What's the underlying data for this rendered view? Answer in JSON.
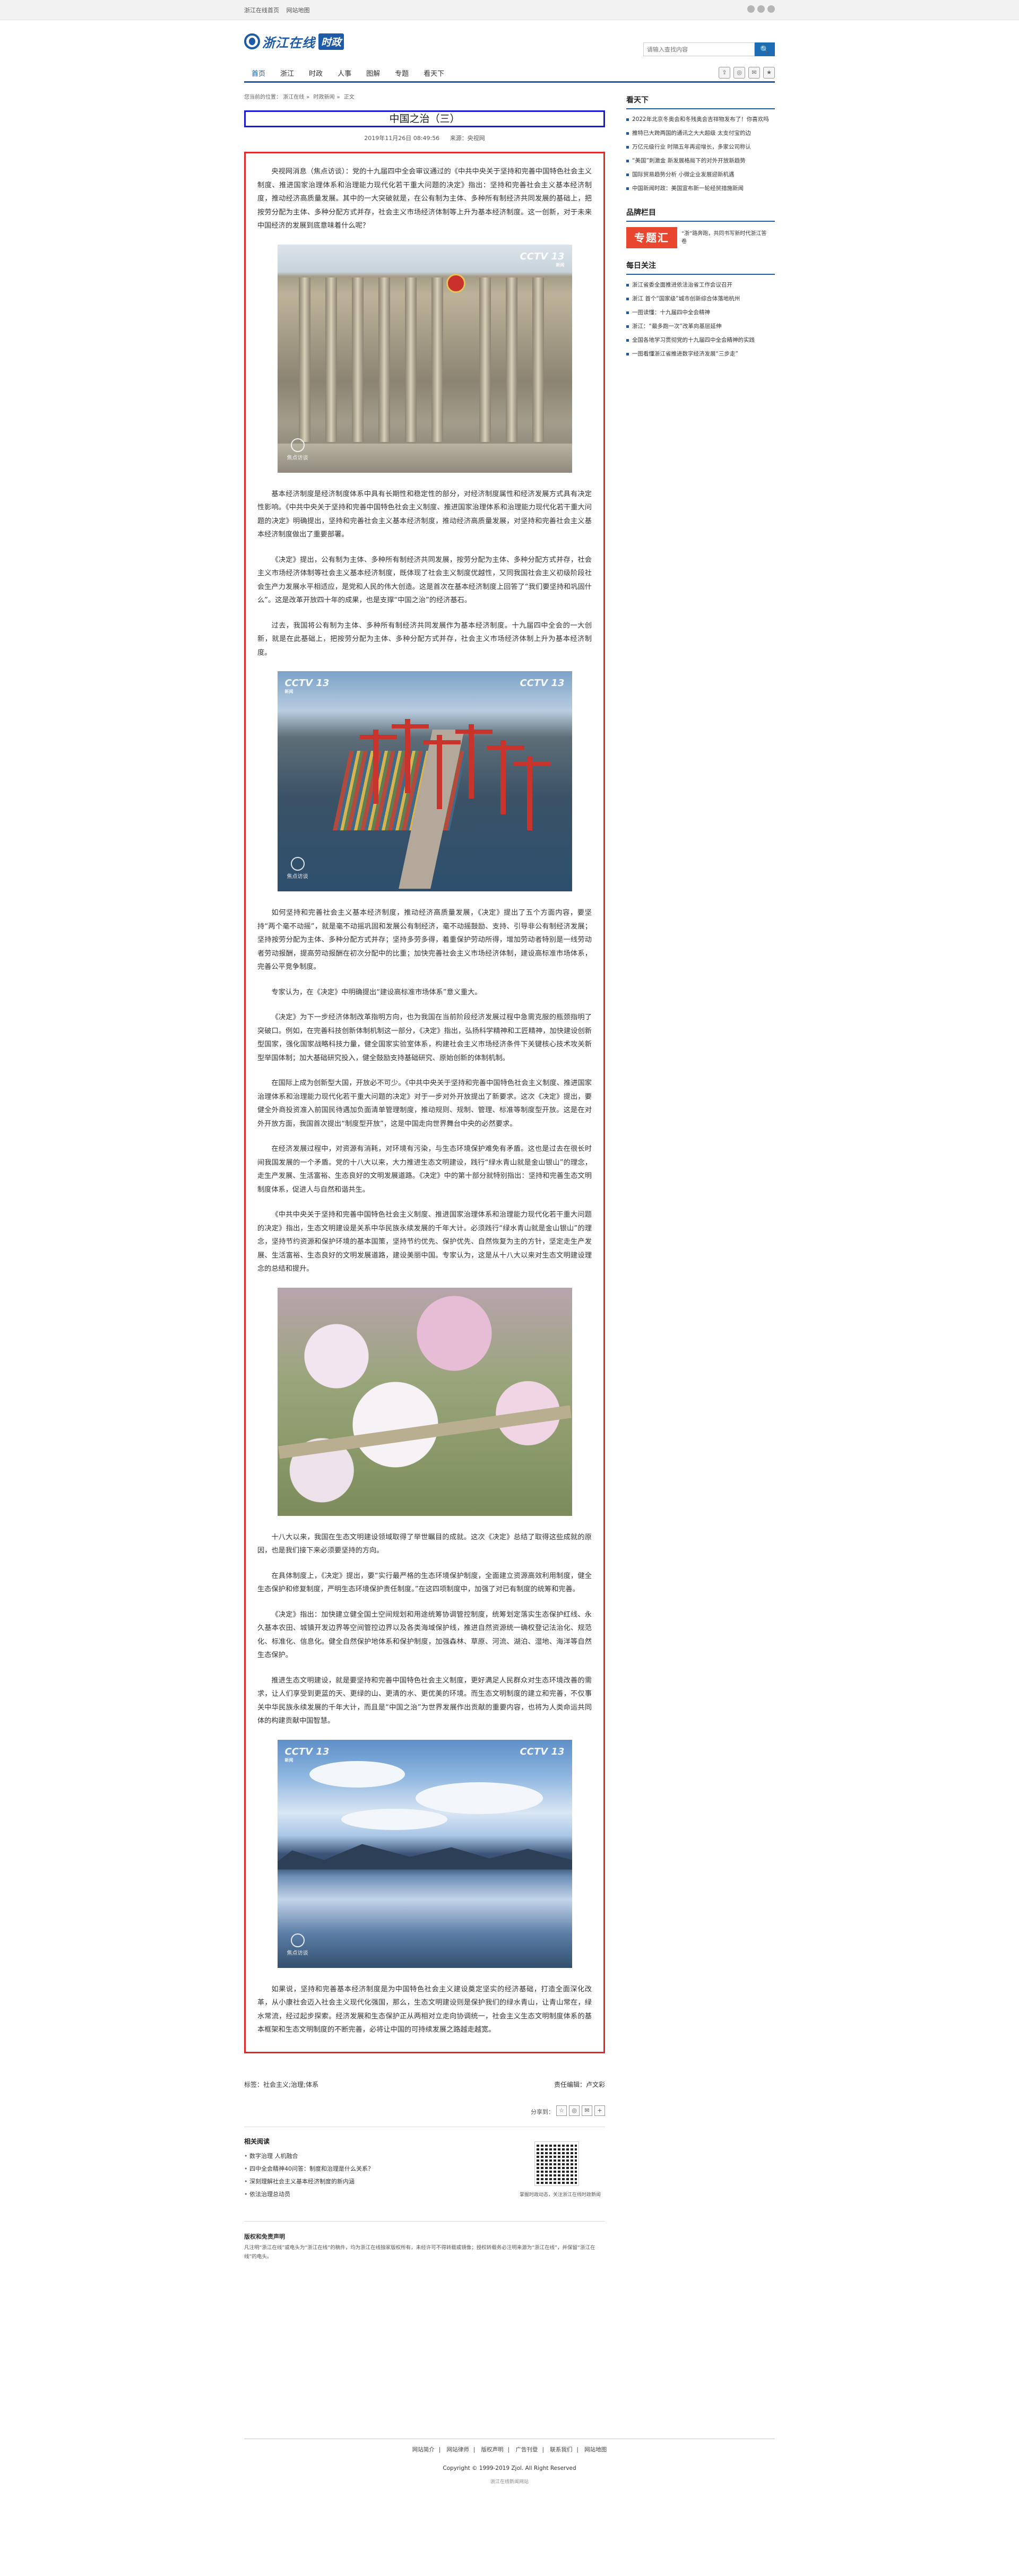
{
  "topbar": {
    "link1": "浙江在线首页",
    "link2": "网站地图"
  },
  "header": {
    "logo_text": "浙江在线",
    "logo_sub": "时政",
    "search_placeholder": "请输入查找内容",
    "search_button": "🔍"
  },
  "nav": {
    "items": [
      "首页",
      "浙江",
      "时政",
      "人事",
      "图解",
      "专题",
      "看天下"
    ]
  },
  "breadcrumb": {
    "label": "您当前的位置：",
    "items": [
      "浙江在线",
      "时政新闻",
      "正文"
    ]
  },
  "article": {
    "title": "中国之治（三）",
    "date": "2019年11月26日 08:49:56",
    "source": "来源：央视网",
    "paragraphs": [
      "央视网消息（焦点访谈）：党的十九届四中全会审议通过的《中共中央关于坚持和完善中国特色社会主义制度、推进国家治理体系和治理能力现代化若干重大问题的决定》指出：坚持和完善社会主义基本经济制度，推动经济高质量发展。其中的一大突破就是，在公有制为主体、多种所有制经济共同发展的基础上，把按劳分配为主体、多种分配方式并存，社会主义市场经济体制等上升为基本经济制度。这一创新，对于未来中国经济的发展到底意味着什么呢？",
      "基本经济制度是经济制度体系中具有长期性和稳定性的部分，对经济制度属性和经济发展方式具有决定性影响。《中共中央关于坚持和完善中国特色社会主义制度、推进国家治理体系和治理能力现代化若干重大问题的决定》明确提出，坚持和完善社会主义基本经济制度，推动经济高质量发展，对坚持和完善社会主义基本经济制度做出了重要部署。",
      "《决定》提出，公有制为主体、多种所有制经济共同发展，按劳分配为主体、多种分配方式并存，社会主义市场经济体制等社会主义基本经济制度，既体现了社会主义制度优越性，又同我国社会主义初级阶段社会生产力发展水平相适应，是党和人民的伟大创造。这是首次在基本经济制度上回答了“我们要坚持和巩固什么”。这是改革开放四十年的成果，也是支撑“中国之治”的经济基石。",
      "过去，我国将公有制为主体、多种所有制经济共同发展作为基本经济制度。十九届四中全会的一大创新，就是在此基础上，把按劳分配为主体、多种分配方式并存，社会主义市场经济体制上升为基本经济制度。",
      "如何坚持和完善社会主义基本经济制度，推动经济高质量发展，《决定》提出了五个方面内容，要坚持“两个毫不动摇”，就是毫不动摇巩固和发展公有制经济，毫不动摇鼓励、支持、引导非公有制经济发展；坚持按劳分配为主体、多种分配方式并存；坚持多劳多得，着重保护劳动所得，增加劳动者特别是一线劳动者劳动报酬，提高劳动报酬在初次分配中的比重；加快完善社会主义市场经济体制，建设高标准市场体系，完善公平竞争制度。",
      "专家认为，在《决定》中明确提出“建设高标准市场体系”意义重大。",
      "《决定》为下一步经济体制改革指明方向，也为我国在当前阶段经济发展过程中急需克服的瓶颈指明了突破口。例如，在完善科技创新体制机制这一部分，《决定》指出，弘扬科学精神和工匠精神，加快建设创新型国家，强化国家战略科技力量，健全国家实验室体系，构建社会主义市场经济条件下关键核心技术攻关新型举国体制；加大基础研究投入，健全鼓励支持基础研究、原始创新的体制机制。",
      "在国际上成为创新型大国，开放必不可少。《中共中央关于坚持和完善中国特色社会主义制度、推进国家治理体系和治理能力现代化若干重大问题的决定》对于一步对外开放提出了新要求。这次《决定》提出，要健全外商投资准入前国民待遇加负面清单管理制度，推动规则、规制、管理、标准等制度型开放。这是在对外开放方面，我国首次提出“制度型开放”，这是中国走向世界舞台中央的必然要求。",
      "在经济发展过程中，对资源有消耗，对环境有污染，与生态环境保护难免有矛盾。这也是过去在很长时间我国发展的一个矛盾。党的十八大以来，大力推进生态文明建设，践行“绿水青山就是金山银山”的理念，走生产发展、生活富裕、生态良好的文明发展道路。《决定》中的第十部分就特别指出：坚持和完善生态文明制度体系，促进人与自然和谐共生。",
      "《中共中央关于坚持和完善中国特色社会主义制度、推进国家治理体系和治理能力现代化若干重大问题的决定》指出，生态文明建设是关系中华民族永续发展的千年大计。必须践行“绿水青山就是金山银山”的理念，坚持节约资源和保护环境的基本国策，坚持节约优先、保护优先、自然恢复为主的方针，坚定走生产发展、生活富裕、生态良好的文明发展道路，建设美丽中国。专家认为，这是从十八大以来对生态文明建设理念的总结和提升。",
      "十八大以来，我国在生态文明建设领域取得了举世瞩目的成就。这次《决定》总结了取得这些成就的原因，也是我们接下来必须要坚持的方向。",
      "在具体制度上，《决定》提出，要“实行最严格的生态环境保护制度，全面建立资源高效利用制度，健全生态保护和修复制度，严明生态环境保护责任制度。”在这四项制度中，加强了对已有制度的统筹和完善。",
      "《决定》指出：加快建立健全国土空间规划和用途统筹协调管控制度，统筹划定落实生态保护红线、永久基本农田、城镇开发边界等空间管控边界以及各类海域保护线，推进自然资源统一确权登记法治化、规范化、标准化、信息化。健全自然保护地体系和保护制度，加强森林、草原、河流、湖泊、湿地、海洋等自然生态保护。",
      "推进生态文明建设，就是要坚持和完善中国特色社会主义制度，更好满足人民群众对生态环境改善的需求，让人们享受到更蓝的天、更绿的山、更清的水、更优美的环境。而生态文明制度的建立和完善，不仅事关中华民族永续发展的千年大计，而且是“中国之治”为世界发展作出贡献的重要内容，也将为人类命运共同体的构建贡献中国智慧。",
      "如果说，坚持和完善基本经济制度是为中国特色社会主义建设奠定坚实的经济基础，打造全面深化改革，从小康社会迈入社会主义现代化强国，那么，生态文明建设则是保护我们的绿水青山，让青山常在，绿水常流，经过起步探索。经济发展和生态保护正从两相对立走向协调统一，社会主义生态文明制度体系的基本框架和生态文明制度的不断完善，必将让中国的可持续发展之路越走越宽。"
    ],
    "image_labels": {
      "cctv": "CCTV 13",
      "cctv_sub": "新闻",
      "watermark": "焦点访谈"
    },
    "tags_label": "标签：",
    "tags": "社会主义;治理;体系",
    "editor": "责任编辑：卢文彩",
    "share_label": "分享到："
  },
  "related": {
    "title": "相关阅读",
    "items": [
      "数字治理 人机融合",
      "四中全会精神40问答：制度和治理是什么关系？",
      "深刻理解社会主义基本经济制度的新内涵",
      "依法治理总动员"
    ],
    "qr_caption": "掌握时政动态，关注浙江在线时政新闻"
  },
  "notice": {
    "title": "版权和免责声明",
    "text1": "凡注明“浙江在线”或电头为“浙江在线”的稿件，均为浙江在线独家版权所有，未经许可不得转载或镜像；授权转载务必注明来源为“浙江在线”，并保留“浙江在线”的电头。"
  },
  "sidebar": {
    "block1_title": "看天下",
    "block1_items": [
      "2022年北京冬奥会和冬残奥会吉祥物发布了！你喜欢吗",
      "推特已大跨两国的通讯之大大超级 太支付宝的边",
      "万亿元级行业 时隔五年再迎增长，多家公司称认",
      "“美国”刺激金 新发展格局下的对外开放新趋势",
      "国际贸易趋势分析 小微企业发展迎新机遇",
      "中国新闻时政：美国宣布新一轮经贸措施新闻"
    ],
    "block2_title": "品牌栏目",
    "brand_name": "专题汇",
    "brand_text": "“浙”路奔跑，共同书写新时代浙江答卷",
    "block3_title": "每日关注",
    "block3_items": [
      "浙江省委全面推进依法治省工作会议召开",
      "浙江 首个“国家级”城市创新综合体落地杭州",
      "一图读懂：十九届四中全会精神",
      "浙江：“最多跑一次”改革向基层延伸",
      "全国各地学习贯彻党的十九届四中全会精神的实践",
      "一图看懂浙江省推进数字经济发展“三步走”"
    ]
  },
  "footer": {
    "links": [
      "网站简介",
      "网站律师",
      "版权声明",
      "广告刊登",
      "联系我们",
      "网站地图"
    ],
    "copyright": "Copyright © 1999-2019 Zjol. All Right Reserved",
    "small": "浙江在线新闻网站"
  }
}
